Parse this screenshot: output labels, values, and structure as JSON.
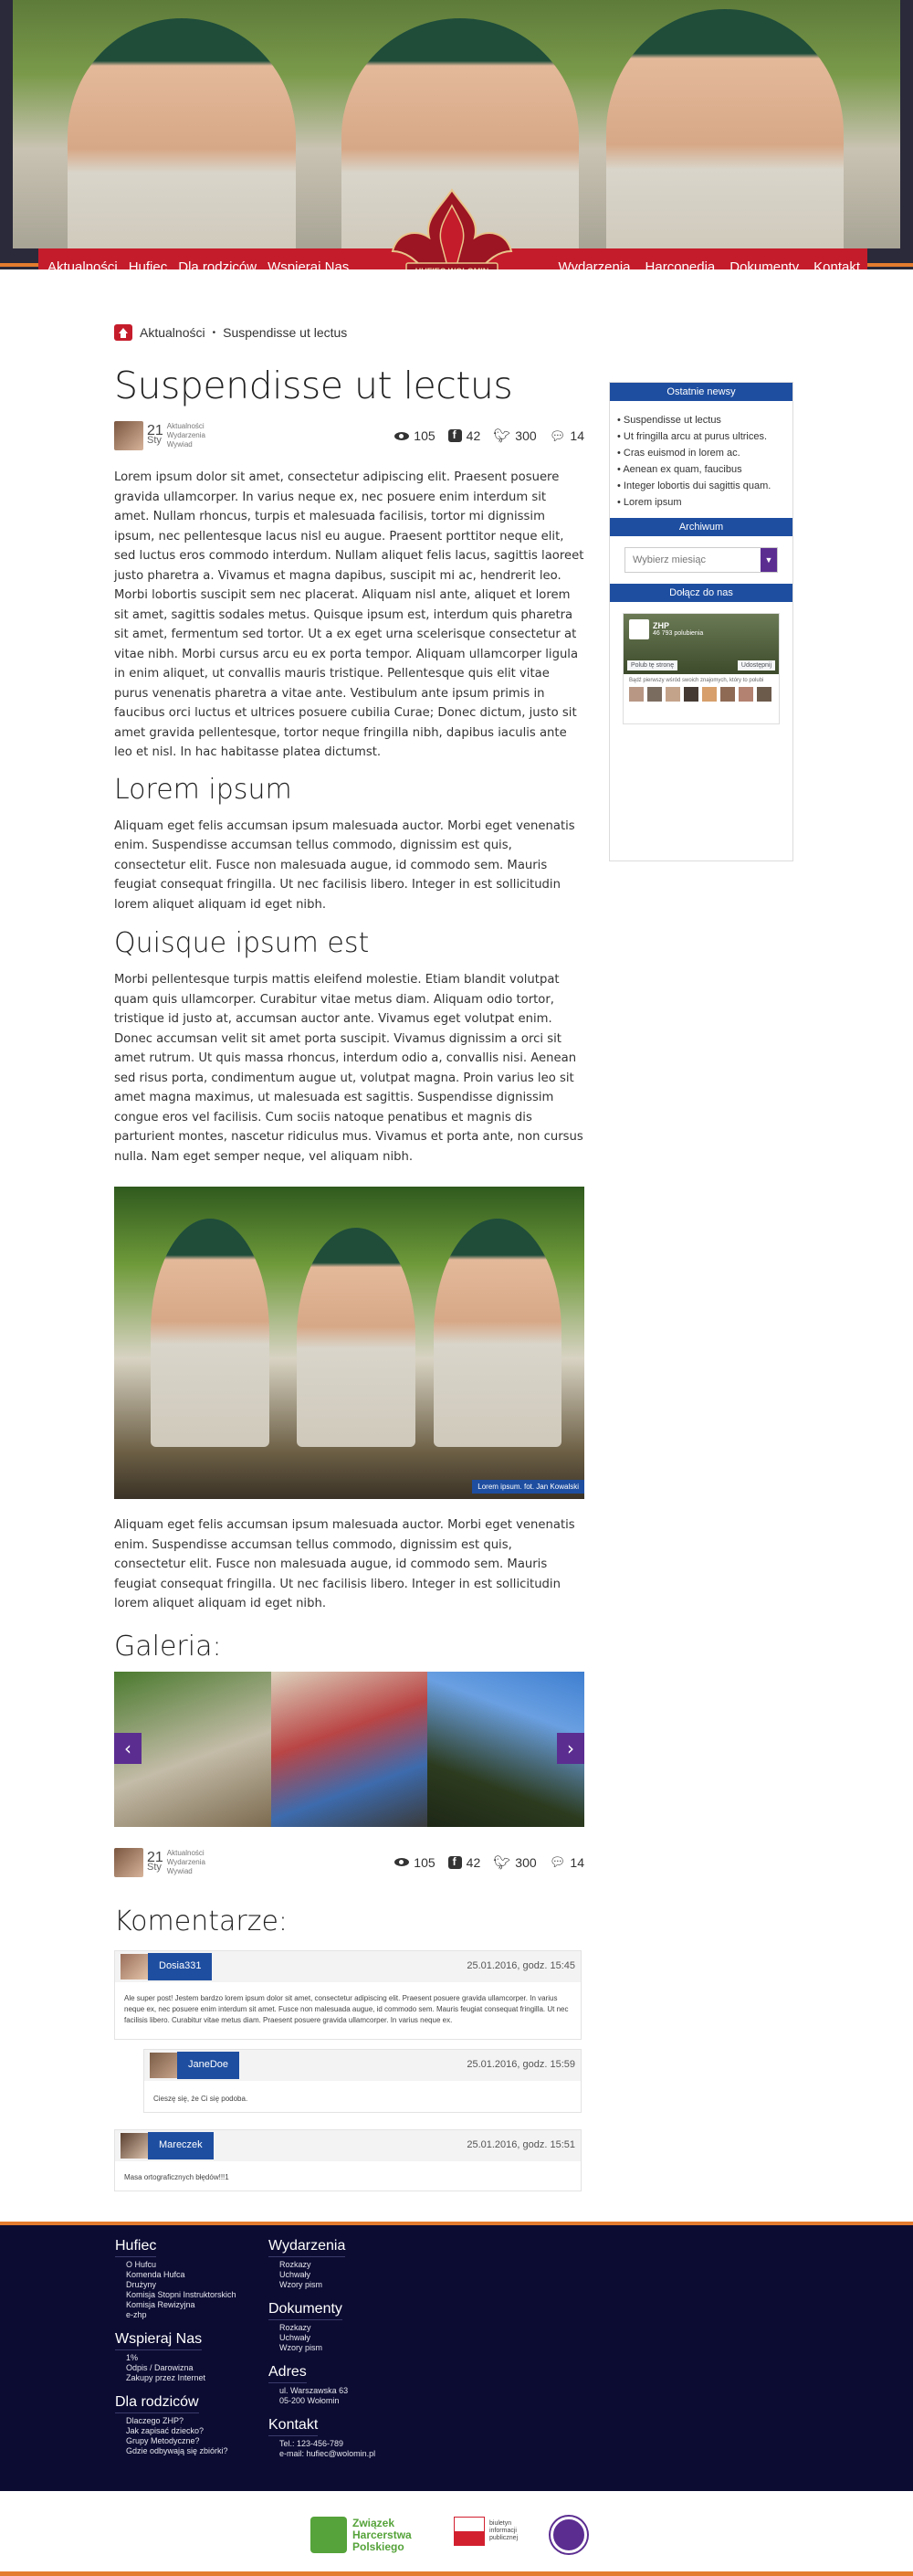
{
  "nav": {
    "left": [
      "Aktualności",
      "Hufiec",
      "Dla rodziców",
      "Wspieraj Nas"
    ],
    "right": [
      "Wydarzenia",
      "Harcopedia",
      "Dokumenty",
      "Kontakt"
    ],
    "crest_text": "HUFIEC WOŁOMIN"
  },
  "breadcrumb": {
    "items": [
      "Aktualności",
      "Suspendisse ut lectus"
    ]
  },
  "article": {
    "title": "Suspendisse ut lectus",
    "meta": {
      "day": "21",
      "month": "Sty",
      "categories": [
        "Aktualności",
        "Wydarzenia",
        "Wywiad"
      ],
      "views": "105",
      "facebook": "42",
      "twitter": "300",
      "comments": "14"
    },
    "p1": "Lorem ipsum dolor sit amet, consectetur adipiscing elit. Praesent posuere gravida ullamcorper. In varius neque ex, nec posuere enim interdum sit amet. Nullam rhoncus, turpis et malesuada facilisis, tortor mi dignissim ipsum, nec pellentesque lacus nisl eu augue. Praesent porttitor neque elit, sed luctus eros commodo interdum. Nullam aliquet felis lacus, sagittis laoreet justo pharetra a. Vivamus et magna dapibus, suscipit mi ac, hendrerit leo. Morbi lobortis suscipit sem nec placerat. Aliquam nisl ante, aliquet et lorem sit amet, sagittis sodales metus. Quisque ipsum est, interdum quis pharetra sit amet, fermentum sed tortor. Ut a ex eget urna scelerisque consectetur at vitae nibh. Morbi cursus arcu eu ex porta tempor. Aliquam ullamcorper ligula in enim aliquet, ut convallis mauris tristique. Pellentesque quis elit vitae purus venenatis pharetra a vitae ante. Vestibulum ante ipsum primis in faucibus orci luctus et ultrices posuere cubilia Curae; Donec dictum, justo sit amet gravida pellentesque, tortor neque fringilla nibh, dapibus iaculis ante leo et nisl. In hac habitasse platea dictumst.",
    "h2a": "Lorem ipsum",
    "p2": "Aliquam eget felis accumsan ipsum malesuada auctor. Morbi eget venenatis enim. Suspendisse accumsan tellus commodo, dignissim est quis, consectetur elit. Fusce non malesuada augue, id commodo sem. Mauris feugiat consequat fringilla. Ut nec facilisis libero. Integer in est sollicitudin lorem aliquet aliquam id eget nibh.",
    "h2b": "Quisque ipsum est",
    "p3": "Morbi pellentesque turpis mattis eleifend molestie. Etiam blandit volutpat quam quis ullamcorper. Curabitur vitae metus diam. Aliquam odio tortor, tristique id justo at, accumsan auctor ante. Vivamus eget volutpat enim. Donec accumsan velit sit amet porta suscipit. Vivamus dignissim a orci sit amet rutrum. Ut quis massa rhoncus, interdum odio a, convallis nisi. Aenean sed risus porta, condimentum augue ut, volutpat magna. Proin varius leo sit amet magna maximus, ut malesuada est sagittis. Suspendisse dignissim congue eros vel facilisis. Cum sociis natoque penatibus et magnis dis parturient montes, nascetur ridiculus mus. Vivamus et porta ante, non cursus nulla. Nam eget semper neque, vel aliquam nibh.",
    "image_caption": "Lorem ipsum. fot. Jan Kowalski",
    "p4": "Aliquam eget felis accumsan ipsum malesuada auctor. Morbi eget venenatis enim. Suspendisse accumsan tellus commodo, dignissim est quis, consectetur elit. Fusce non malesuada augue, id commodo sem. Mauris feugiat consequat fringilla. Ut nec facilisis libero. Integer in est sollicitudin lorem aliquet aliquam id eget nibh.",
    "gallery_title": "Galeria:",
    "comments_title": "Komentarze:"
  },
  "comments": [
    {
      "author": "Dosia331",
      "time": "25.01.2016, godz. 15:45",
      "text": "Ale super post! Jestem bardzo lorem ipsum dolor sit amet, consectetur adipiscing elit. Praesent posuere gravida ullamcorper. In varius neque ex, nec posuere enim interdum sit amet. Fusce non malesuada augue, id commodo sem. Mauris feugiat consequat fringilla. Ut nec facilisis libero. Curabitur vitae metus diam. Praesent posuere gravida ullamcorper. In varius neque ex."
    },
    {
      "author": "JaneDoe",
      "time": "25.01.2016, godz. 15:59",
      "text": "Cieszę się, że Ci się podoba."
    },
    {
      "author": "Mareczek",
      "time": "25.01.2016, godz. 15:51",
      "text": "Masa ortograficznych błędów!!!1"
    }
  ],
  "sidebar": {
    "news_title": "Ostatnie newsy",
    "news": [
      "Suspendisse ut lectus",
      "Ut fringilla arcu at purus ultrices.",
      "Cras euismod in lorem ac.",
      "Aenean ex quam, faucibus",
      "Integer lobortis dui sagittis quam.",
      "Lorem ipsum"
    ],
    "archive_title": "Archiwum",
    "archive_placeholder": "Wybierz miesiąc",
    "join_title": "Dołącz do nas",
    "fb_name": "ZHP",
    "fb_likes": "46 793 polubienia",
    "fb_like_btn": "Polub tę stronę",
    "fb_share_btn": "Udostępnij",
    "fb_text": "Bądź pierwszy wśród swoich znajomych, który to polubi"
  },
  "footer": {
    "col1": [
      {
        "title": "Hufiec",
        "items": [
          "O Hufcu",
          "Komenda Hufca",
          "Drużyny",
          "Komisja Stopni Instruktorskich",
          "Komisja Rewizyjna",
          "e-zhp"
        ]
      },
      {
        "title": "Wspieraj Nas",
        "items": [
          "1%",
          "Odpis / Darowizna",
          "Zakupy przez Internet"
        ]
      },
      {
        "title": "Dla rodziców",
        "items": [
          "Dlaczego ZHP?",
          "Jak zapisać dziecko?",
          "Grupy Metodyczne?",
          "Gdzie odbywają się zbiórki?"
        ]
      }
    ],
    "col2": [
      {
        "title": "Wydarzenia",
        "items": [
          "Rozkazy",
          "Uchwały",
          "Wzory pism"
        ]
      },
      {
        "title": "Dokumenty",
        "items": [
          "Rozkazy",
          "Uchwały",
          "Wzory pism"
        ]
      },
      {
        "title": "Adres",
        "items": [
          "ul. Warszawska 63",
          "05-200 Wołomin"
        ]
      },
      {
        "title": "Kontakt",
        "items": [
          "Tel.: 123-456-789",
          "e-mail: hufiec@wolomin.pl"
        ]
      }
    ]
  },
  "partners": {
    "zhp": [
      "Związek",
      "Harcerstwa",
      "Polskiego"
    ],
    "bip": "biuletyn informacji publicznej"
  },
  "colors": {
    "red": "#c51c2b",
    "blue": "#1e4ea0",
    "purple": "#5b2d91",
    "orange": "#e37c2e",
    "navy": "#0c0c33"
  }
}
